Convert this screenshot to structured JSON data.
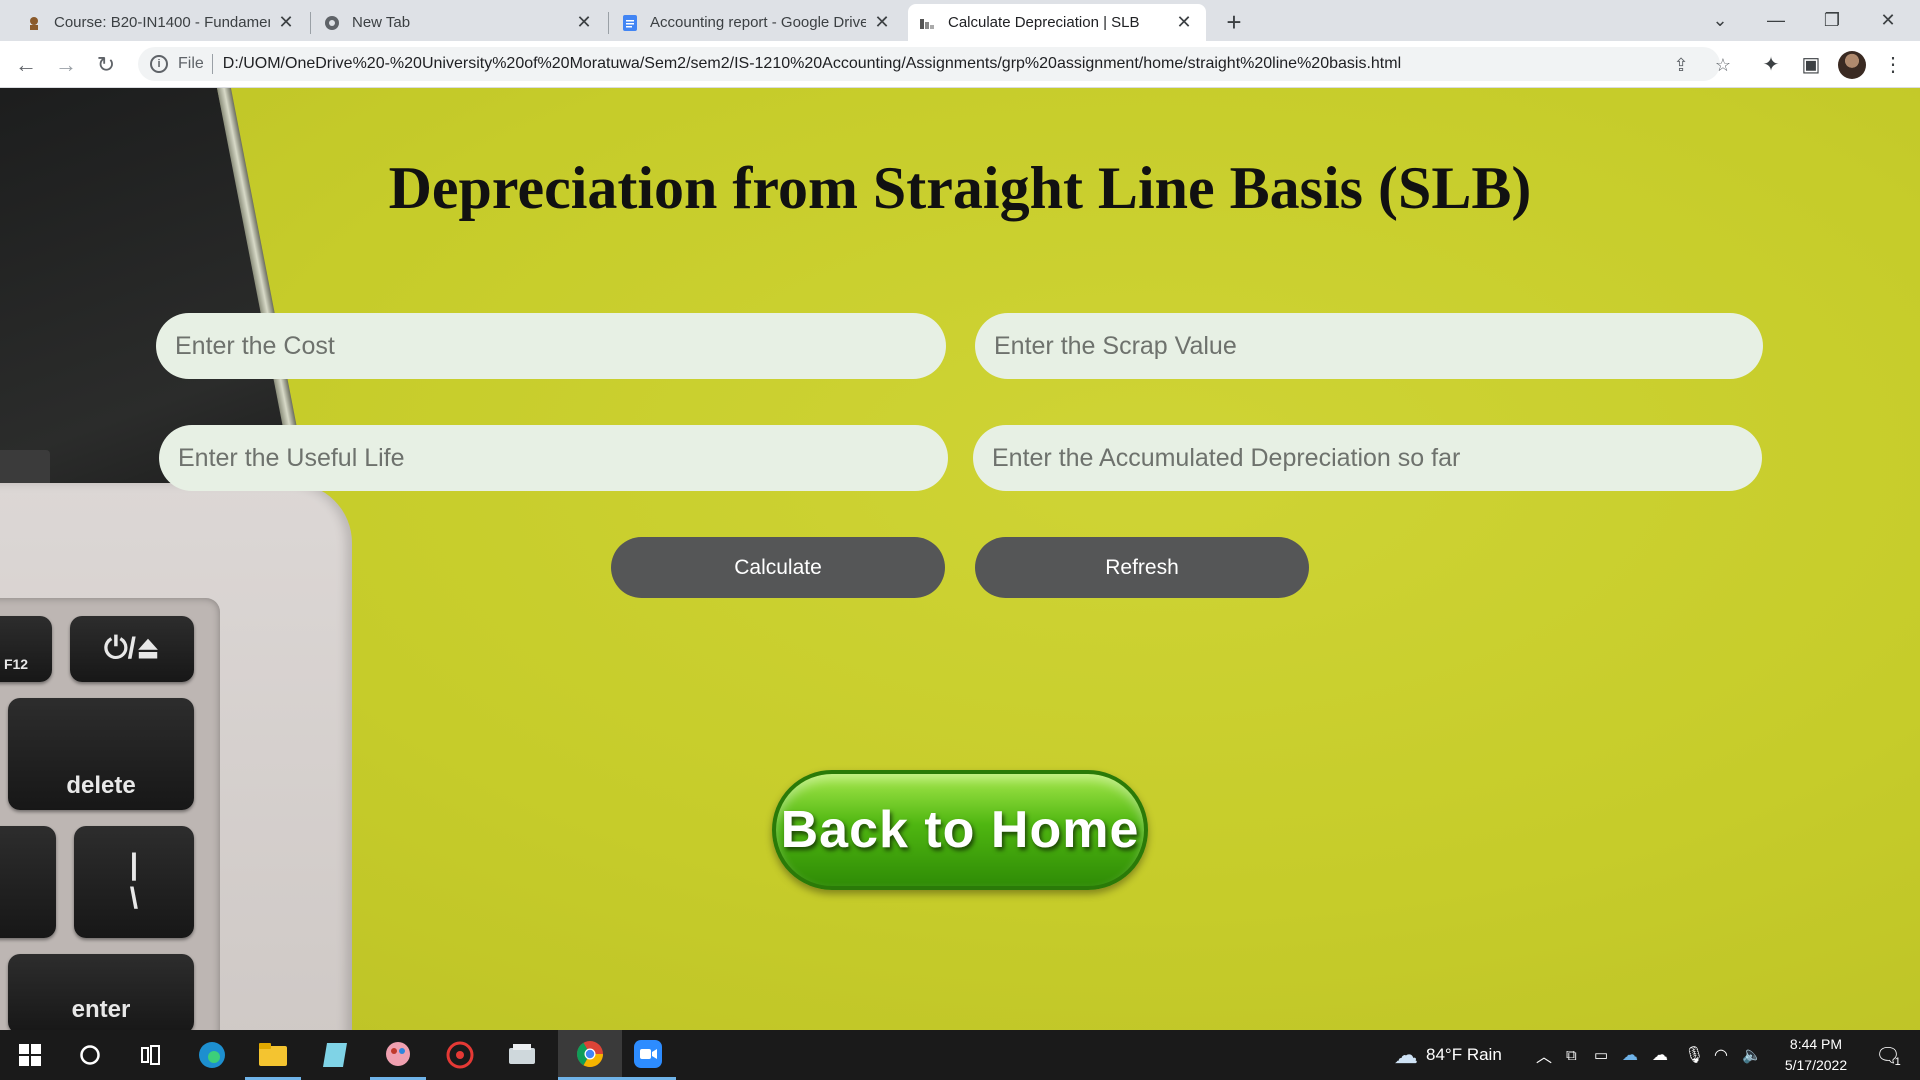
{
  "browser": {
    "tabs": [
      {
        "title": "Course: B20-IN1400 - Fundamen",
        "icon": "moodle-icon"
      },
      {
        "title": "New Tab",
        "icon": "chrome-icon"
      },
      {
        "title": "Accounting report - Google Drive",
        "icon": "google-docs-icon"
      },
      {
        "title": "Calculate Depreciation | SLB",
        "icon": "page-icon",
        "active": true
      }
    ],
    "address": {
      "scheme_label": "File",
      "url": "D:/UOM/OneDrive%20-%20University%20of%20Moratuwa/Sem2/sem2/IS-1210%20Accounting/Assignments/grp%20assignment/home/straight%20line%20basis.html"
    }
  },
  "page": {
    "title": "Depreciation from Straight Line Basis (SLB)",
    "fields": {
      "cost_placeholder": "Enter the Cost",
      "scrap_placeholder": "Enter the Scrap Value",
      "life_placeholder": "Enter the Useful Life",
      "accum_placeholder": "Enter the Accumulated Depreciation so far"
    },
    "buttons": {
      "calculate": "Calculate",
      "refresh": "Refresh",
      "home": "Back to Home"
    },
    "background_keys": {
      "f12": "F12",
      "power": "⏻/⏏",
      "delete": "delete",
      "pipe": "|\n\\",
      "enter": "enter"
    }
  },
  "taskbar": {
    "weather": "84°F  Rain",
    "time": "8:44 PM",
    "date": "5/17/2022",
    "notification_count": "1"
  },
  "colors": {
    "page_bg": "#c9cf2e",
    "button_bg": "#555657",
    "field_bg": "#e7f0e4",
    "home_green": "#4fb611"
  }
}
